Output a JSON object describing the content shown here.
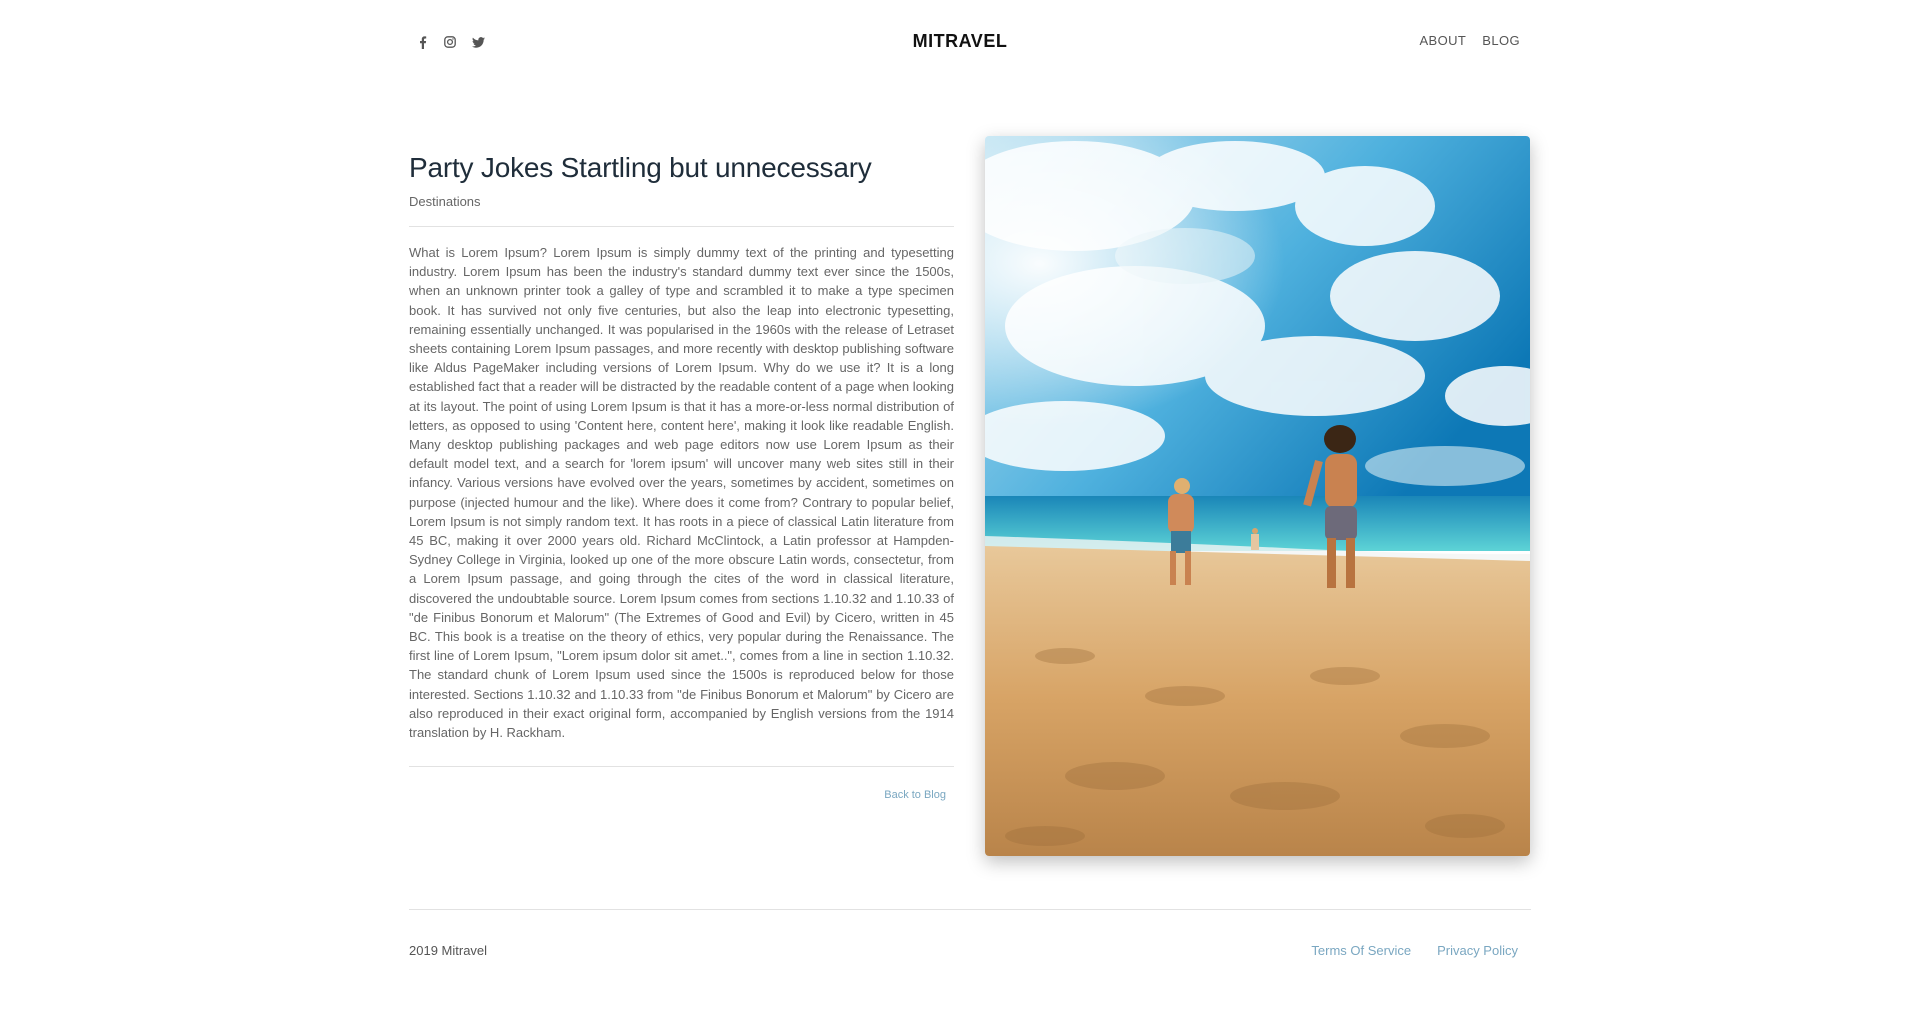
{
  "header": {
    "logo": "MITRAVEL",
    "social": [
      "facebook-icon",
      "instagram-icon",
      "twitter-icon"
    ],
    "nav": {
      "about": "ABOUT",
      "blog": "BLOG"
    }
  },
  "article": {
    "title": "Party Jokes Startling but unnecessary",
    "category": "Destinations",
    "body": "What is Lorem Ipsum? Lorem Ipsum is simply dummy text of the printing and typesetting industry. Lorem Ipsum has been the industry's standard dummy text ever since the 1500s, when an unknown printer took a galley of type and scrambled it to make a type specimen book. It has survived not only five centuries, but also the leap into electronic typesetting, remaining essentially unchanged. It was popularised in the 1960s with the release of Letraset sheets containing Lorem Ipsum passages, and more recently with desktop publishing software like Aldus PageMaker including versions of Lorem Ipsum. Why do we use it? It is a long established fact that a reader will be distracted by the readable content of a page when looking at its layout. The point of using Lorem Ipsum is that it has a more-or-less normal distribution of letters, as opposed to using 'Content here, content here', making it look like readable English. Many desktop publishing packages and web page editors now use Lorem Ipsum as their default model text, and a search for 'lorem ipsum' will uncover many web sites still in their infancy. Various versions have evolved over the years, sometimes by accident, sometimes on purpose (injected humour and the like). Where does it come from? Contrary to popular belief, Lorem Ipsum is not simply random text. It has roots in a piece of classical Latin literature from 45 BC, making it over 2000 years old. Richard McClintock, a Latin professor at Hampden-Sydney College in Virginia, looked up one of the more obscure Latin words, consectetur, from a Lorem Ipsum passage, and going through the cites of the word in classical literature, discovered the undoubtable source. Lorem Ipsum comes from sections 1.10.32 and 1.10.33 of \"de Finibus Bonorum et Malorum\" (The Extremes of Good and Evil) by Cicero, written in 45 BC. This book is a treatise on the theory of ethics, very popular during the Renaissance. The first line of Lorem Ipsum, \"Lorem ipsum dolor sit amet..\", comes from a line in section 1.10.32. The standard chunk of Lorem Ipsum used since the 1500s is reproduced below for those interested. Sections 1.10.32 and 1.10.33 from \"de Finibus Bonorum et Malorum\" by Cicero are also reproduced in their exact original form, accompanied by English versions from the 1914 translation by H. Rackham.",
    "back_link": "Back to Blog"
  },
  "footer": {
    "copyright": "2019 Mitravel",
    "terms": "Terms Of Service",
    "privacy": "Privacy Policy"
  },
  "colors": {
    "link": "#7aa7c1",
    "title": "#1f2d3a",
    "sky": "#1f8fc9",
    "sand": "#d9a86a"
  }
}
